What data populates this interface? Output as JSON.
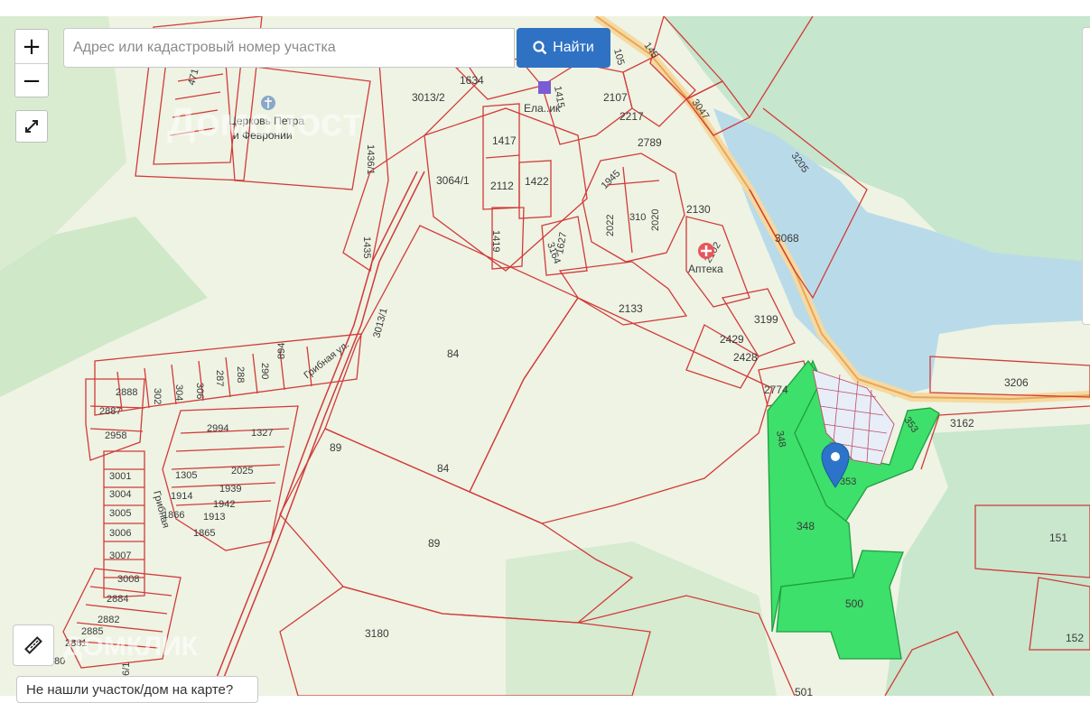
{
  "search": {
    "placeholder": "Адрес или кадастровый номер участка",
    "button_label": "Найти"
  },
  "zoom": {
    "in_label": "+",
    "out_label": "−"
  },
  "bottom_tip": "Не нашли участок/дом на карте?",
  "watermarks": {
    "top": "Домопост",
    "bottom": "ДОМКЛИК"
  },
  "pois": {
    "church_line1": "Церковь Петра",
    "church_line2": "и Февронии",
    "village_partial": "Ела..ик",
    "pharmacy_partial": "Аптека"
  },
  "street_labels": {
    "main": "Грибная ул.",
    "side": "Грибная"
  },
  "parcels": [
    "471",
    "3013/2",
    "1634",
    "1415",
    "2107",
    "2217",
    "3047",
    "145",
    "105",
    "3205",
    "1417",
    "2112",
    "1422",
    "3064/1",
    "1436/1",
    "1945",
    "2022",
    "310",
    "2020",
    "2130",
    "2789",
    "1419",
    "1627",
    "3164",
    "2102",
    "3068",
    "1435",
    "3013/1",
    "2133",
    "3199",
    "2429",
    "2428",
    "2774",
    "3206",
    "3162",
    "84",
    "84",
    "89",
    "89",
    "302",
    "304",
    "306",
    "287",
    "288",
    "290",
    "894",
    "2888",
    "2887",
    "2958",
    "2994",
    "1327",
    "2025",
    "1939",
    "1305",
    "1942",
    "1914",
    "1913",
    "1866",
    "1865",
    "3001",
    "3004",
    "3005",
    "3006",
    "3007",
    "3008",
    "2884",
    "2882",
    "2885",
    "2881",
    "3180",
    "348",
    "348",
    "353",
    "353",
    "500",
    "151",
    "152",
    "501",
    "36/1"
  ],
  "highlighted_parcels": [
    "348",
    "353",
    "500"
  ],
  "colors": {
    "parcel_border": "#d23a3a",
    "highlight_fill": "#3de06a",
    "water": "#b9dbe9",
    "forest": "#c9e8cf",
    "button": "#2f72c4",
    "marker": "#2d73c9",
    "road": "#f2c66d"
  },
  "icons": [
    "search-icon",
    "expand-icon",
    "ruler-icon",
    "location-pin-icon",
    "church-icon",
    "pharmacy-icon",
    "map-marker-icon"
  ]
}
